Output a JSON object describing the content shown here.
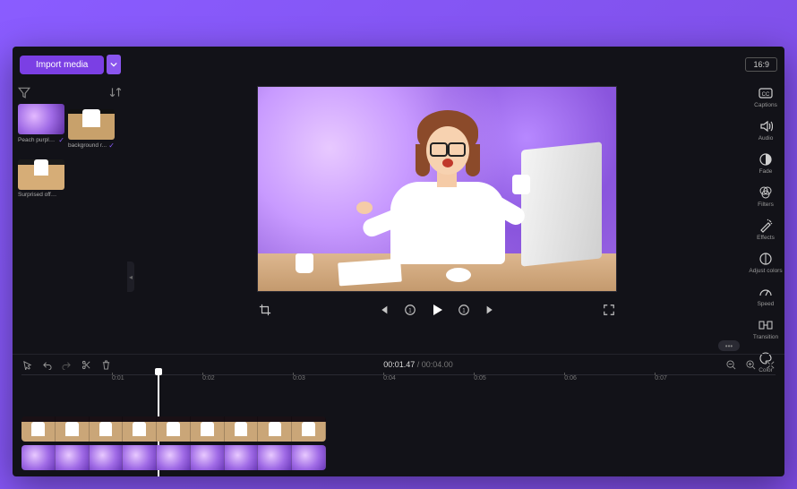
{
  "topbar": {
    "import_label": "Import media",
    "aspect_ratio": "16:9"
  },
  "media": {
    "items": [
      {
        "name": "Peach purple ...",
        "added": true
      },
      {
        "name": "background r...",
        "added": true
      },
      {
        "name": "Surprised office ..",
        "added": false
      }
    ]
  },
  "rail": [
    {
      "id": "captions",
      "label": "Captions"
    },
    {
      "id": "audio",
      "label": "Audio"
    },
    {
      "id": "fade",
      "label": "Fade"
    },
    {
      "id": "filters",
      "label": "Filters"
    },
    {
      "id": "effects",
      "label": "Effects"
    },
    {
      "id": "adjust-colors",
      "label": "Adjust colors"
    },
    {
      "id": "speed",
      "label": "Speed"
    },
    {
      "id": "transition",
      "label": "Transition"
    },
    {
      "id": "color",
      "label": "Color"
    }
  ],
  "playback": {
    "current": "00:01.47",
    "separator": "/",
    "duration": "00:04.00"
  },
  "ruler": {
    "ticks": [
      "0:01",
      "0:02",
      "0:03",
      "0:04",
      "0:05",
      "0:06",
      "0:07"
    ]
  },
  "overflow_label": "•••"
}
